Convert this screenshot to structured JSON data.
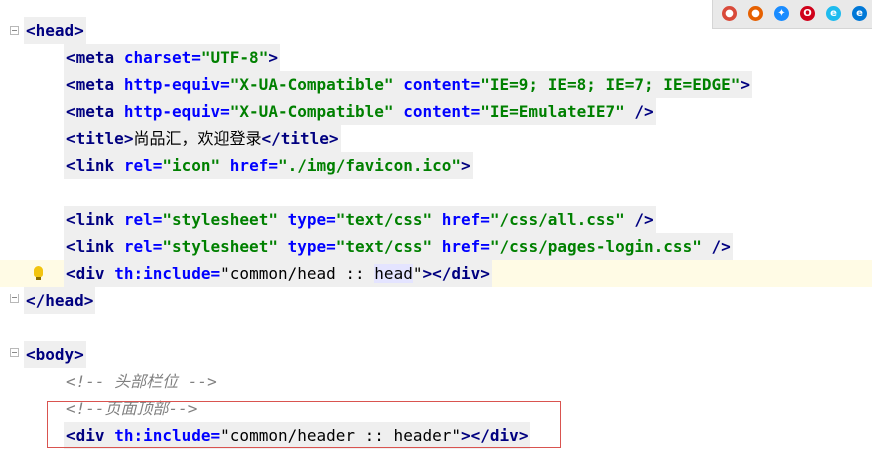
{
  "browser_icons": [
    {
      "name": "chrome-icon",
      "color": "#d94a3a"
    },
    {
      "name": "firefox-icon",
      "color": "#e66000"
    },
    {
      "name": "safari-icon",
      "color": "#1a8cff"
    },
    {
      "name": "opera-icon",
      "color": "#d0021b"
    },
    {
      "name": "ie-icon",
      "color": "#1ebbee"
    },
    {
      "name": "edge-icon",
      "color": "#0078d7"
    }
  ],
  "lines": {
    "l1": {
      "open": "<",
      "tag": "head",
      "close": ">"
    },
    "l2": {
      "open": "<",
      "tag": "meta",
      "attr1": "charset",
      "eq1": "=",
      "val1": "\"UTF-8\"",
      "close": ">"
    },
    "l3": {
      "open": "<",
      "tag": "meta",
      "attr1": "http-equiv",
      "eq1": "=",
      "val1": "\"X-UA-Compatible\"",
      "attr2": "content",
      "eq2": "=",
      "val2": "\"IE=9; IE=8; IE=7; IE=EDGE\"",
      "close": ">"
    },
    "l4": {
      "open": "<",
      "tag": "meta",
      "attr1": "http-equiv",
      "eq1": "=",
      "val1": "\"X-UA-Compatible\"",
      "attr2": "content",
      "eq2": "=",
      "val2": "\"IE=EmulateIE7\"",
      "close": " />"
    },
    "l5": {
      "open": "<",
      "tag": "title",
      "close": ">",
      "text": "尚品汇，欢迎登录",
      "end_open": "</",
      "end_tag": "title",
      "end_close": ">"
    },
    "l6": {
      "open": "<",
      "tag": "link",
      "attr1": "rel",
      "eq1": "=",
      "val1": "\"icon\"",
      "attr2": "href",
      "eq2": "=",
      "val2": "\"./img/favicon.ico\"",
      "close": ">"
    },
    "l8": {
      "open": "<",
      "tag": "link",
      "attr1": "rel",
      "eq1": "=",
      "val1": "\"stylesheet\"",
      "attr2": "type",
      "eq2": "=",
      "val2": "\"text/css\"",
      "attr3": "href",
      "eq3": "=",
      "val3": "\"/css/all.css\"",
      "close": " />"
    },
    "l9": {
      "open": "<",
      "tag": "link",
      "attr1": "rel",
      "eq1": "=",
      "val1": "\"stylesheet\"",
      "attr2": "type",
      "eq2": "=",
      "val2": "\"text/css\"",
      "attr3": "href",
      "eq3": "=",
      "val3": "\"/css/pages-login.css\"",
      "close": " />"
    },
    "l10": {
      "open": "<",
      "tag": "div",
      "attr1": "th:include",
      "eq1": "=",
      "q1": "\"",
      "text_a": "common/head :: ",
      "text_b": "head",
      "q2": "\"",
      "close": ">",
      "end_open": "</",
      "end_tag": "div",
      "end_close": ">"
    },
    "l11": {
      "open": "</",
      "tag": "head",
      "close": ">"
    },
    "l13": {
      "open": "<",
      "tag": "body",
      "close": ">"
    },
    "l14": {
      "comment": "<!-- 头部栏位 -->"
    },
    "l15": {
      "comment": "<!--页面顶部-->"
    },
    "l16": {
      "open": "<",
      "tag": "div",
      "attr1": "th:include",
      "eq1": "=",
      "q1": "\"",
      "text_a": "common/header :: header",
      "q2": "\"",
      "close": ">",
      "end_open": "</",
      "end_tag": "div",
      "end_close": ">"
    }
  }
}
